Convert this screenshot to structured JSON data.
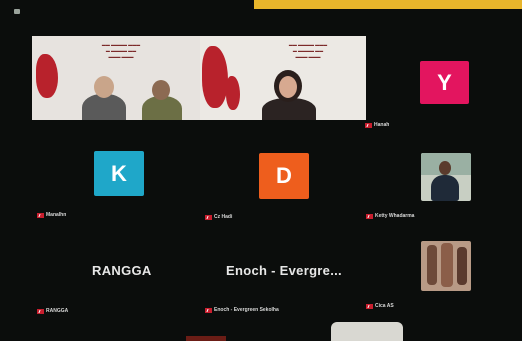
{
  "participants": [
    {
      "name": "Hanah",
      "initial": "Y",
      "avatar_color": "#e3155f"
    },
    {
      "name": "Manalhn",
      "initial": "K",
      "avatar_color": "#1fa7c9"
    },
    {
      "name": "Cz Hadi",
      "initial": "D",
      "avatar_color": "#ee5e1d"
    },
    {
      "name": "Ketty Whadarma",
      "initial": ""
    },
    {
      "name": "RANGGA",
      "display": "RANGGA"
    },
    {
      "name": "Enoch - Evergreen Sekolha",
      "display": "Enoch - Evergre..."
    },
    {
      "name": "Cica AS",
      "initial": ""
    }
  ],
  "colors": {
    "accent": "#e8b52b",
    "mic_muted": "#c81e2e"
  }
}
